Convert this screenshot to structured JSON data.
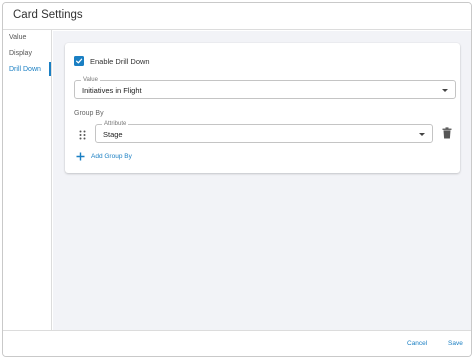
{
  "dialog": {
    "title": "Card Settings"
  },
  "sidebar": {
    "items": [
      {
        "label": "Value",
        "active": false
      },
      {
        "label": "Display",
        "active": false
      },
      {
        "label": "Drill Down",
        "active": true
      }
    ]
  },
  "drill_down": {
    "enable_label": "Enable Drill Down",
    "enabled": true,
    "value_field": {
      "legend": "Value",
      "selected": "Initiatives in Flight"
    },
    "group_by_label": "Group By",
    "attribute_field": {
      "legend": "Attribute",
      "selected": "Stage"
    },
    "add_group_label": "Add Group By"
  },
  "footer": {
    "cancel_label": "Cancel",
    "save_label": "Save"
  },
  "colors": {
    "accent": "#1a7fc3",
    "content_bg": "#f2f3f7"
  }
}
